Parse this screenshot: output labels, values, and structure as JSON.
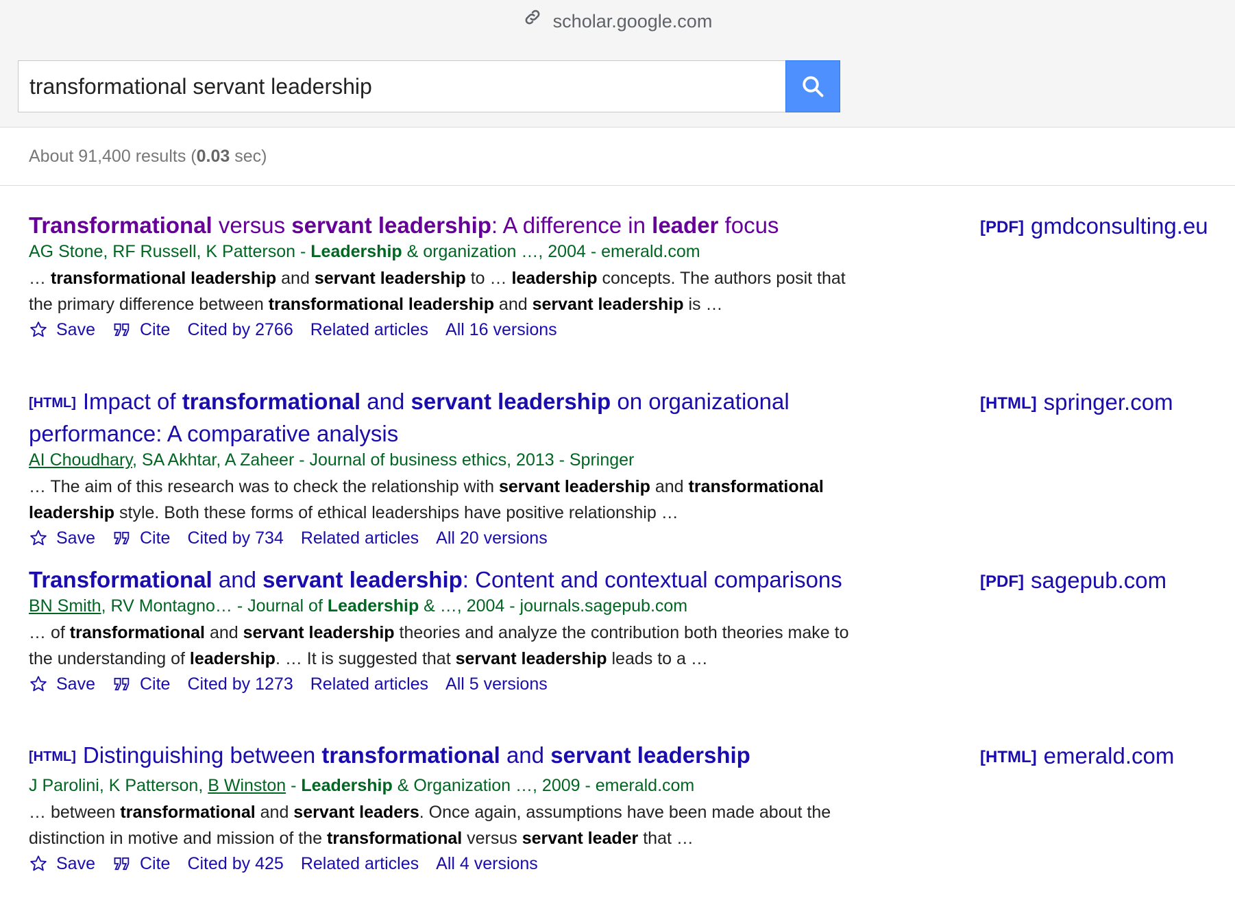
{
  "browser": {
    "url": "scholar.google.com"
  },
  "search": {
    "query": "transformational servant leadership"
  },
  "stats": {
    "prefix": "About 91,400 results (",
    "time": "0.03",
    "suffix": " sec)"
  },
  "colors": {
    "link": "#1a0dab",
    "visited": "#660099",
    "meta": "#006621",
    "search_button": "#4d90fe"
  },
  "actions": {
    "save": "Save",
    "cite": "Cite",
    "related": "Related articles"
  },
  "results": [
    {
      "title_parts": [
        [
          "Transformational",
          true
        ],
        [
          " versus ",
          false
        ],
        [
          "servant leadership",
          true
        ],
        [
          ": A difference in ",
          false
        ],
        [
          "leader",
          true
        ],
        [
          " focus",
          false
        ]
      ],
      "visited": true,
      "meta_parts": [
        [
          "AG Stone, RF Russell, K Patterson - ",
          "n"
        ],
        [
          "Leadership",
          "b"
        ],
        [
          " & organization …, 2004 - emerald.com",
          "n"
        ]
      ],
      "snippet_parts": [
        [
          "… ",
          false
        ],
        [
          "transformational leadership",
          true
        ],
        [
          " and ",
          false
        ],
        [
          "servant leadership",
          true
        ],
        [
          " to … ",
          false
        ],
        [
          "leadership",
          true
        ],
        [
          " concepts. The authors posit that the primary difference between ",
          false
        ],
        [
          "transformational leadership",
          true
        ],
        [
          " and ",
          false
        ],
        [
          "servant leadership",
          true
        ],
        [
          " is …",
          false
        ]
      ],
      "cited_by": "Cited by 2766",
      "versions": "All 16 versions",
      "side_tag": "[PDF]",
      "side_domain": "gmdconsulting.eu"
    },
    {
      "type_tag": "[HTML]",
      "title_parts": [
        [
          "Impact of ",
          false
        ],
        [
          "transformational",
          true
        ],
        [
          " and ",
          false
        ],
        [
          "servant leadership",
          true
        ],
        [
          " on organizational performance: A comparative analysis",
          false
        ]
      ],
      "visited": false,
      "meta_parts": [
        [
          "AI Choudhary",
          "u"
        ],
        [
          ", SA Akhtar, A Zaheer - Journal of business ethics, 2013 - Springer",
          "n"
        ]
      ],
      "snippet_parts": [
        [
          "… The aim of this research was to check the relationship with ",
          false
        ],
        [
          "servant leadership",
          true
        ],
        [
          " and ",
          false
        ],
        [
          "transformational leadership",
          true
        ],
        [
          " style. Both these forms of ethical leaderships have positive relationship …",
          false
        ]
      ],
      "cited_by": "Cited by 734",
      "versions": "All 20 versions",
      "side_tag": "[HTML]",
      "side_domain": "springer.com"
    },
    {
      "title_parts": [
        [
          "Transformational",
          true
        ],
        [
          " and ",
          false
        ],
        [
          "servant leadership",
          true
        ],
        [
          ": Content and contextual comparisons",
          false
        ]
      ],
      "visited": false,
      "meta_parts": [
        [
          "BN Smith",
          "u"
        ],
        [
          ", RV Montagno… - Journal of ",
          "n"
        ],
        [
          "Leadership",
          "b"
        ],
        [
          " & …, 2004 - journals.sagepub.com",
          "n"
        ]
      ],
      "snippet_parts": [
        [
          "… of ",
          false
        ],
        [
          "transformational",
          true
        ],
        [
          " and ",
          false
        ],
        [
          "servant leadership",
          true
        ],
        [
          " theories and analyze the contribution both theories make to the understanding of ",
          false
        ],
        [
          "leadership",
          true
        ],
        [
          ". … It is suggested that ",
          false
        ],
        [
          "servant leadership",
          true
        ],
        [
          " leads to a …",
          false
        ]
      ],
      "cited_by": "Cited by 1273",
      "versions": "All 5 versions",
      "side_tag": "[PDF]",
      "side_domain": "sagepub.com"
    },
    {
      "type_tag": "[HTML]",
      "title_parts": [
        [
          "Distinguishing between ",
          false
        ],
        [
          "transformational",
          true
        ],
        [
          " and ",
          false
        ],
        [
          "servant leadership",
          true
        ]
      ],
      "visited": false,
      "meta_parts": [
        [
          "J Parolini, K Patterson, ",
          "n"
        ],
        [
          "B Winston",
          "u"
        ],
        [
          " - ",
          "n"
        ],
        [
          "Leadership",
          "b"
        ],
        [
          " & Organization …, 2009 - emerald.com",
          "n"
        ]
      ],
      "snippet_parts": [
        [
          "… between ",
          false
        ],
        [
          "transformational",
          true
        ],
        [
          " and ",
          false
        ],
        [
          "servant leaders",
          true
        ],
        [
          ". Once again, assumptions have been made about the distinction in motive and mission of the ",
          false
        ],
        [
          "transformational",
          true
        ],
        [
          " versus ",
          false
        ],
        [
          "servant leader",
          true
        ],
        [
          " that …",
          false
        ]
      ],
      "cited_by": "Cited by 425",
      "versions": "All 4 versions",
      "side_tag": "[HTML]",
      "side_domain": "emerald.com"
    }
  ]
}
